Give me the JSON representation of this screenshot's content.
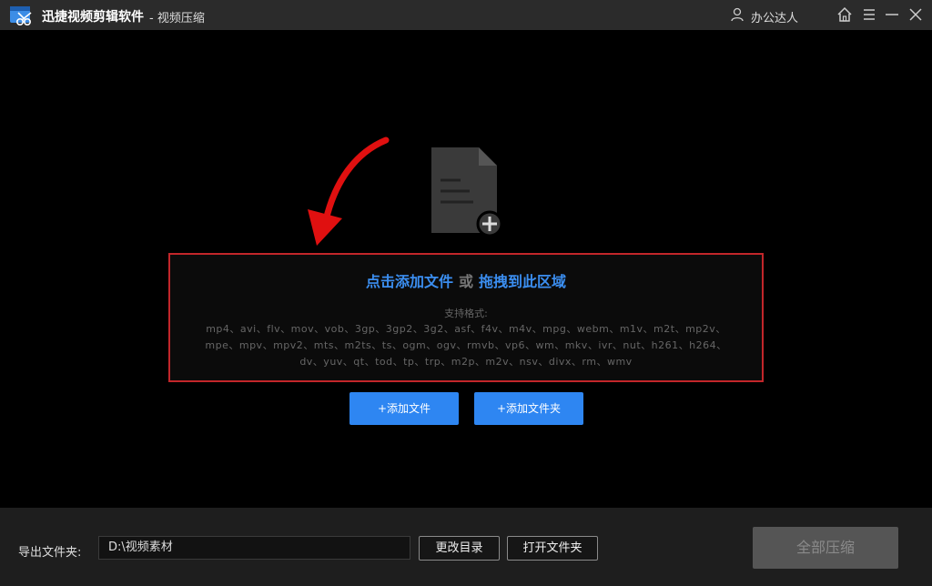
{
  "titlebar": {
    "app_name": "迅捷视频剪辑软件",
    "subtitle": "- 视频压缩",
    "user_name": "办公达人"
  },
  "drop_zone": {
    "click_add": "点击添加文件",
    "or": "或",
    "drag_here": "拖拽到此区域",
    "formats_label": "支持格式:",
    "formats_line1": "mp4、avi、flv、mov、vob、3gp、3gp2、3g2、asf、f4v、m4v、mpg、webm、m1v、m2t、mp2v、",
    "formats_line2": "mpe、mpv、mpv2、mts、m2ts、ts、ogm、ogv、rmvb、vp6、wm、mkv、ivr、nut、h261、h264、",
    "formats_line3": "dv、yuv、qt、tod、tp、trp、m2p、m2v、nsv、divx、rm、wmv"
  },
  "buttons": {
    "add_file": "+添加文件",
    "add_folder": "+添加文件夹"
  },
  "output": {
    "label": "导出文件夹:",
    "path": "D:\\视频素材",
    "change_dir": "更改目录",
    "open_folder": "打开文件夹",
    "compress_all": "全部压缩"
  },
  "colors": {
    "accent": "#2e86f2",
    "link": "#3b8ef0",
    "highlight_border": "#c2262a",
    "annotation_arrow": "#e01010"
  }
}
